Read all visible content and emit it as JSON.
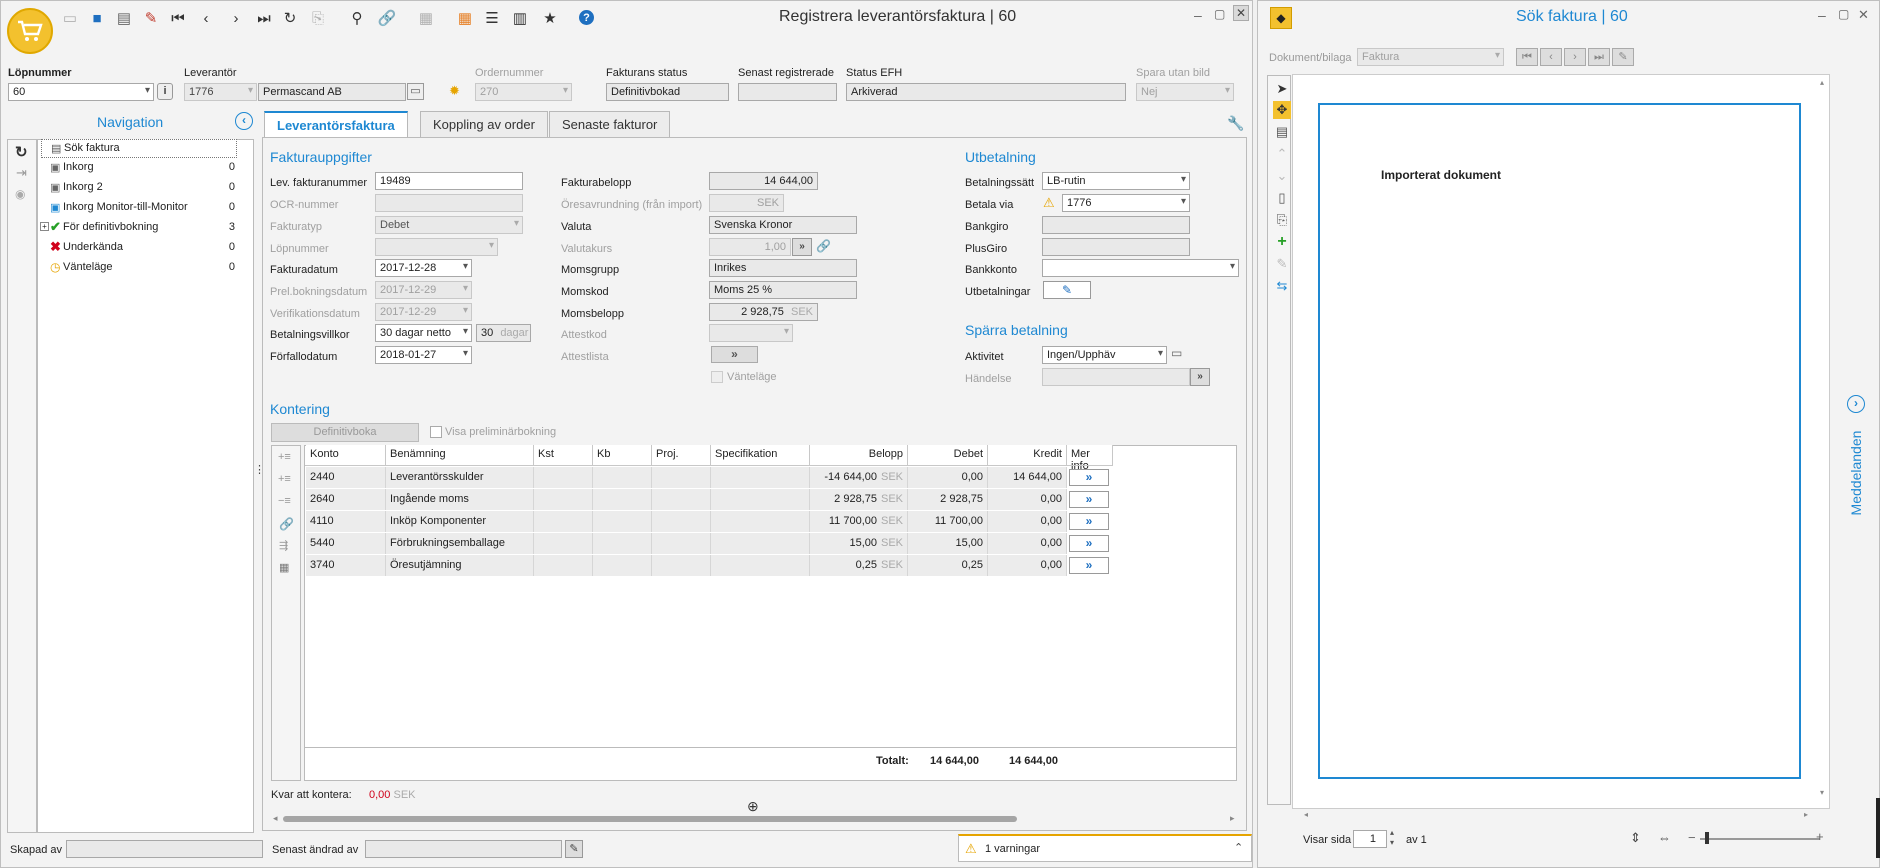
{
  "main_window": {
    "title": "Registrera leverantörsfaktura | 60"
  },
  "header": {
    "lopnummer_label": "Löpnummer",
    "lopnummer_value": "60",
    "leverantor_label": "Leverantör",
    "leverantor_id": "1776",
    "leverantor_name": "Permascand AB",
    "ordernummer_label": "Ordernummer",
    "ordernummer_value": "270",
    "status_label": "Fakturans status",
    "status_value": "Definitivbokad",
    "senast_label": "Senast registrerade",
    "senast_value": "",
    "efh_label": "Status EFH",
    "efh_value": "Arkiverad",
    "spara_label": "Spara utan bild",
    "spara_value": "Nej"
  },
  "navigation": {
    "title": "Navigation",
    "items": [
      {
        "label": "Sök faktura",
        "count": ""
      },
      {
        "label": "Inkorg",
        "count": "0"
      },
      {
        "label": "Inkorg 2",
        "count": "0"
      },
      {
        "label": "Inkorg Monitor-till-Monitor",
        "count": "0"
      },
      {
        "label": "För definitivbokning",
        "count": "3"
      },
      {
        "label": "Underkända",
        "count": "0"
      },
      {
        "label": "Vänteläge",
        "count": "0"
      }
    ]
  },
  "tabs": [
    "Leverantörsfaktura",
    "Koppling av order",
    "Senaste fakturor"
  ],
  "fakturauppgifter": {
    "title": "Fakturauppgifter",
    "lev_fakturanummer_label": "Lev. fakturanummer",
    "lev_fakturanummer": "19489",
    "ocr_label": "OCR-nummer",
    "ocr": "",
    "fakturatyp_label": "Fakturatyp",
    "fakturatyp": "Debet",
    "lopnummer_label": "Löpnummer",
    "lopnummer": "",
    "fakturadatum_label": "Fakturadatum",
    "fakturadatum": "2017-12-28",
    "prel_label": "Prel.bokningsdatum",
    "prel": "2017-12-29",
    "verifikation_label": "Verifikationsdatum",
    "verifikation": "2017-12-29",
    "betalningsvillkor_label": "Betalningsvillkor",
    "betalningsvillkor": "30 dagar netto",
    "dagar_num": "30",
    "dagar_label": "dagar",
    "forfallodatum_label": "Förfallodatum",
    "forfallodatum": "2018-01-27",
    "fakturabelopp_label": "Fakturabelopp",
    "fakturabelopp": "14 644,00",
    "oresavrundning_label": "Öresavrundning (från import)",
    "oresavrundning_unit": "SEK",
    "valuta_label": "Valuta",
    "valuta": "Svenska Kronor",
    "valutakurs_label": "Valutakurs",
    "valutakurs": "1,00",
    "momsgrupp_label": "Momsgrupp",
    "momsgrupp": "Inrikes",
    "momskod_label": "Momskod",
    "momskod": "Moms 25 %",
    "momsbelopp_label": "Momsbelopp",
    "momsbelopp": "2 928,75",
    "momsbelopp_unit": "SEK",
    "attestkod_label": "Attestkod",
    "attestlista_label": "Attestlista",
    "vantelage_label": "Vänteläge"
  },
  "utbetalning": {
    "title": "Utbetalning",
    "betalningssatt_label": "Betalningssätt",
    "betalningssatt": "LB-rutin",
    "betala_via_label": "Betala via",
    "betala_via": "1776",
    "bankgiro_label": "Bankgiro",
    "plusgiro_label": "PlusGiro",
    "bankkonto_label": "Bankkonto",
    "utbetalningar_label": "Utbetalningar"
  },
  "sparra": {
    "title": "Spärra betalning",
    "aktivitet_label": "Aktivitet",
    "aktivitet": "Ingen/Upphäv",
    "handelse_label": "Händelse"
  },
  "kontering": {
    "title": "Kontering",
    "definitivboka_label": "Definitivboka",
    "visa_prelim_label": "Visa preliminärbokning",
    "columns": [
      "Konto",
      "Benämning",
      "Kst",
      "Kb",
      "Proj.",
      "Specifikation",
      "Belopp",
      "Debet",
      "Kredit",
      "Mer info"
    ],
    "rows": [
      {
        "konto": "2440",
        "benamning": "Leverantörsskulder",
        "belopp": "-14 644,00",
        "unit": "SEK",
        "debet": "0,00",
        "kredit": "14 644,00"
      },
      {
        "konto": "2640",
        "benamning": "Ingående moms",
        "belopp": "2 928,75",
        "unit": "SEK",
        "debet": "2 928,75",
        "kredit": "0,00"
      },
      {
        "konto": "4110",
        "benamning": "Inköp Komponenter",
        "belopp": "11 700,00",
        "unit": "SEK",
        "debet": "11 700,00",
        "kredit": "0,00"
      },
      {
        "konto": "5440",
        "benamning": "Förbrukningsemballage",
        "belopp": "15,00",
        "unit": "SEK",
        "debet": "15,00",
        "kredit": "0,00"
      },
      {
        "konto": "3740",
        "benamning": "Öresutjämning",
        "belopp": "0,25",
        "unit": "SEK",
        "debet": "0,25",
        "kredit": "0,00"
      }
    ],
    "totalt_label": "Totalt:",
    "totalt_debet": "14 644,00",
    "totalt_kredit": "14 644,00",
    "kvar_label": "Kvar att kontera:",
    "kvar_value": "0,00",
    "kvar_unit": "SEK"
  },
  "footer": {
    "skapad_label": "Skapad av",
    "andrad_label": "Senast ändrad av",
    "warnings": "1 varningar"
  },
  "viewer_window": {
    "title": "Sök faktura | 60",
    "dokument_label": "Dokument/bilaga",
    "dokument_value": "Faktura",
    "document_text": "Importerat dokument",
    "visar_sida_label": "Visar sida",
    "page_value": "1",
    "av_label": "av 1",
    "meddelanden_label": "Meddelanden"
  },
  "colors": {
    "accent": "#1e88d2",
    "logo": "#f3c12e",
    "negative": "#d0021b"
  }
}
